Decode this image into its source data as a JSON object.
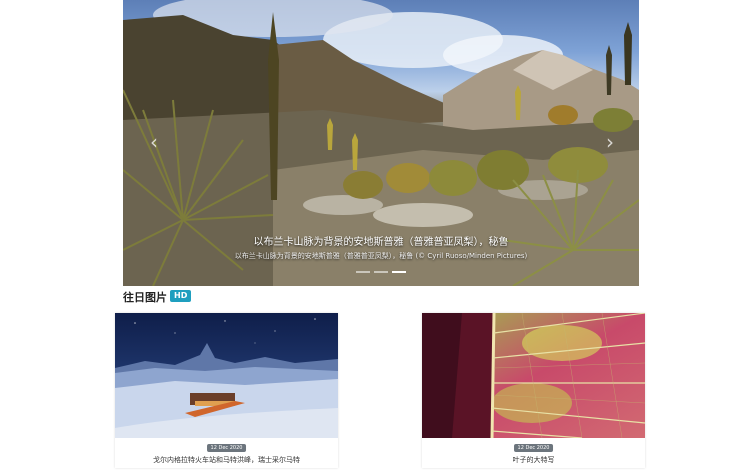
{
  "hero": {
    "caption_title": "以布兰卡山脉为背景的安地斯普雅（普雅普亚凤梨），秘鲁",
    "caption_sub": "以布兰卡山脉为背景的安地斯普雅（普雅普亚凤梨），秘鲁 (© Cyril Ruoso/Minden Pictures)",
    "prev_icon": "chevron-left-icon",
    "next_icon": "chevron-right-icon",
    "indicator_count": 3,
    "active_indicator": 3
  },
  "section": {
    "title": "往日图片",
    "badge": "HD"
  },
  "cards": [
    {
      "date": "12 Dec 2020",
      "title": "戈尔内格拉特火车站和马特洪峰，瑞士采尔马特"
    },
    {
      "date": "12 Dec 2020",
      "title": "叶子的大特写"
    }
  ],
  "colors": {
    "badge": "#1f9fbf",
    "date_badge": "#6c757d"
  }
}
